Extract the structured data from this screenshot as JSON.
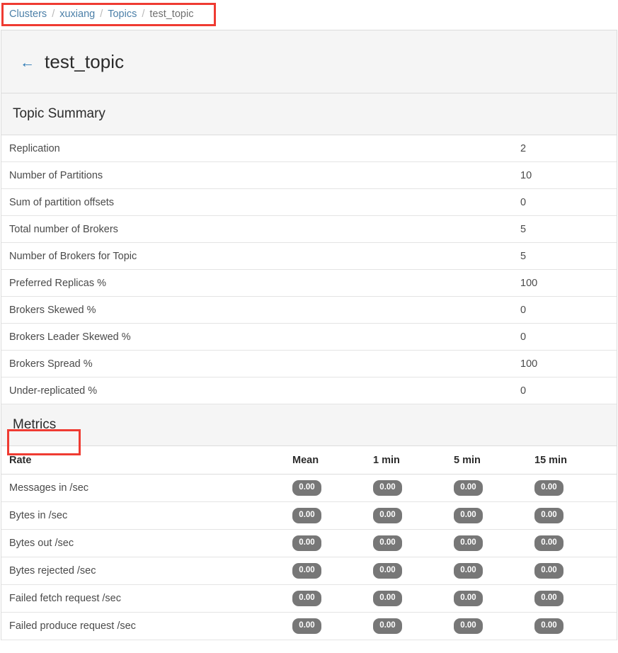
{
  "breadcrumb": {
    "separator": "/",
    "items": [
      {
        "label": "Clusters",
        "current": false
      },
      {
        "label": "xuxiang",
        "current": false
      },
      {
        "label": "Topics",
        "current": false
      },
      {
        "label": "test_topic",
        "current": true
      }
    ]
  },
  "header": {
    "back_icon": "←",
    "title": "test_topic"
  },
  "summary": {
    "section_title": "Topic Summary",
    "rows": [
      {
        "label": "Replication",
        "value": "2"
      },
      {
        "label": "Number of Partitions",
        "value": "10"
      },
      {
        "label": "Sum of partition offsets",
        "value": "0"
      },
      {
        "label": "Total number of Brokers",
        "value": "5"
      },
      {
        "label": "Number of Brokers for Topic",
        "value": "5"
      },
      {
        "label": "Preferred Replicas %",
        "value": "100"
      },
      {
        "label": "Brokers Skewed %",
        "value": "0"
      },
      {
        "label": "Brokers Leader Skewed %",
        "value": "0"
      },
      {
        "label": "Brokers Spread %",
        "value": "100"
      },
      {
        "label": "Under-replicated %",
        "value": "0"
      }
    ]
  },
  "metrics": {
    "section_title": "Metrics",
    "columns": [
      "Rate",
      "Mean",
      "1 min",
      "5 min",
      "15 min"
    ],
    "rows": [
      {
        "label": "Messages in /sec",
        "mean": "0.00",
        "m1": "0.00",
        "m5": "0.00",
        "m15": "0.00"
      },
      {
        "label": "Bytes in /sec",
        "mean": "0.00",
        "m1": "0.00",
        "m5": "0.00",
        "m15": "0.00"
      },
      {
        "label": "Bytes out /sec",
        "mean": "0.00",
        "m1": "0.00",
        "m5": "0.00",
        "m15": "0.00"
      },
      {
        "label": "Bytes rejected /sec",
        "mean": "0.00",
        "m1": "0.00",
        "m5": "0.00",
        "m15": "0.00"
      },
      {
        "label": "Failed fetch request /sec",
        "mean": "0.00",
        "m1": "0.00",
        "m5": "0.00",
        "m15": "0.00"
      },
      {
        "label": "Failed produce request /sec",
        "mean": "0.00",
        "m1": "0.00",
        "m5": "0.00",
        "m15": "0.00"
      }
    ]
  },
  "colors": {
    "annotation": "#ef3b32",
    "link": "#4b7fa8",
    "badge": "#777777",
    "section_bg": "#f5f5f5"
  }
}
